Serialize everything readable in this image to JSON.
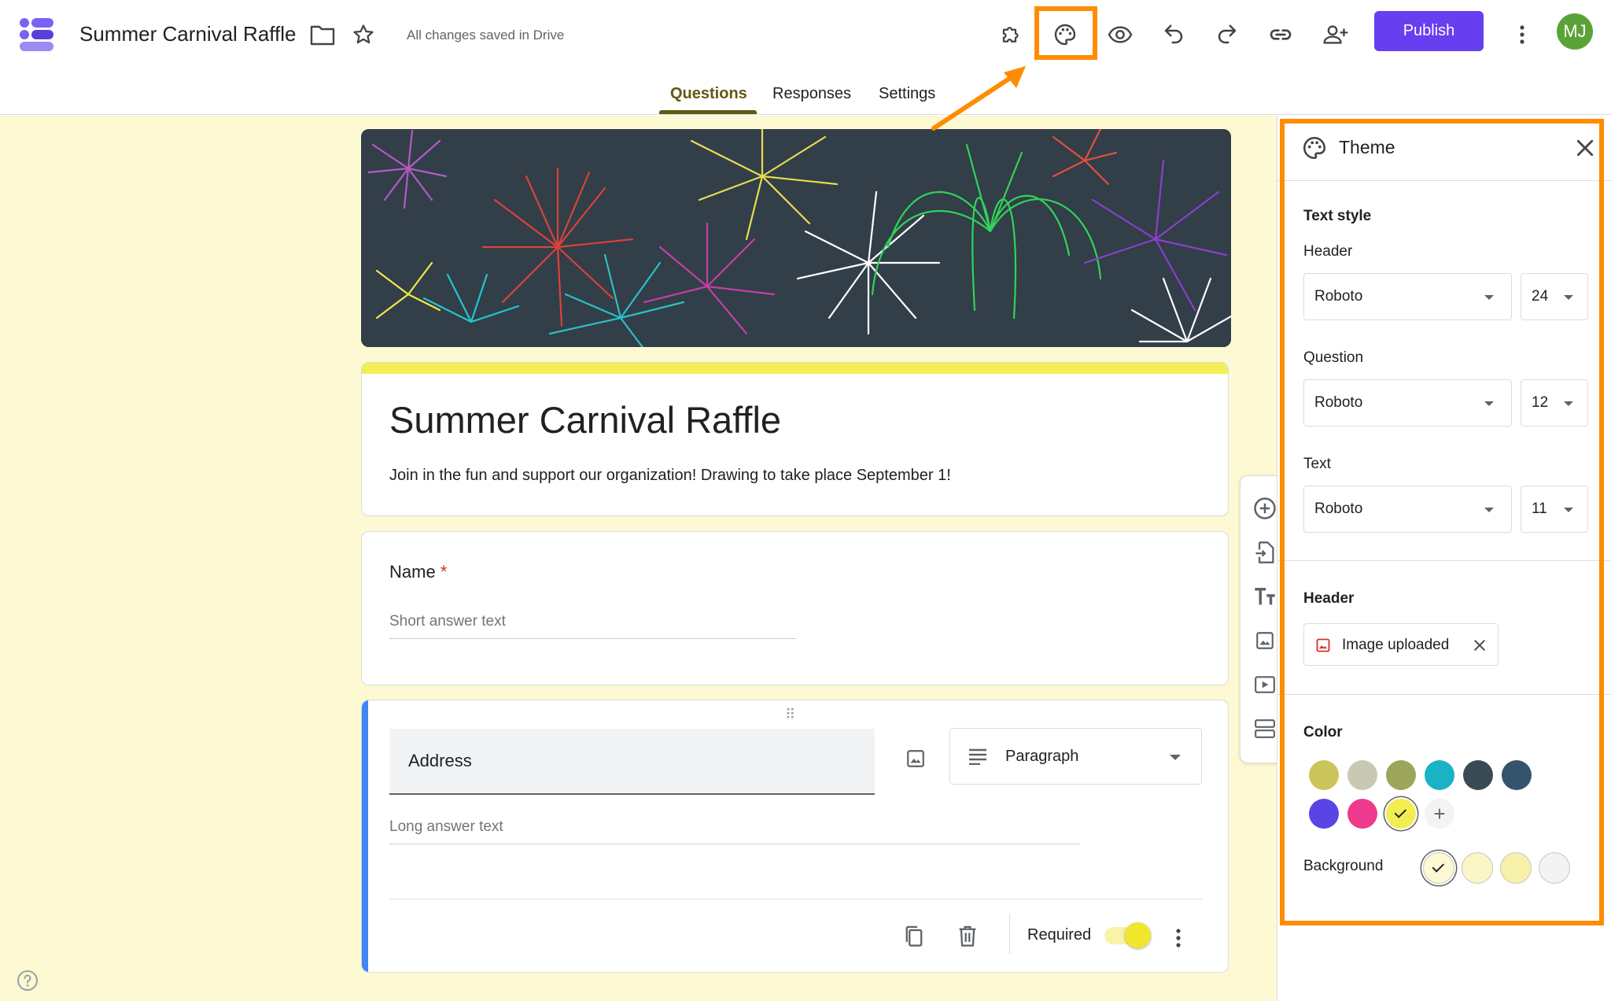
{
  "app": {
    "doc_title": "Summer Carnival Raffle",
    "save_status": "All changes saved in Drive",
    "publish_label": "Publish",
    "avatar_initials": "MJ"
  },
  "tabs": [
    {
      "label": "Questions",
      "active": true
    },
    {
      "label": "Responses",
      "active": false
    },
    {
      "label": "Settings",
      "active": false
    }
  ],
  "form": {
    "title": "Summer Carnival Raffle",
    "description": "Join in the fun and support our organization! Drawing to take place September 1!",
    "questions": [
      {
        "title": "Name",
        "required": true,
        "placeholder": "Short answer text"
      },
      {
        "title": "Address",
        "type": "Paragraph",
        "placeholder": "Long answer text",
        "required_label": "Required",
        "required": true
      }
    ]
  },
  "theme_panel": {
    "title": "Theme",
    "text_style_title": "Text style",
    "header_label": "Header",
    "header_font": "Roboto",
    "header_size": "24",
    "question_label": "Question",
    "question_font": "Roboto",
    "question_size": "12",
    "text_label": "Text",
    "text_font": "Roboto",
    "text_size": "11",
    "header_section_title": "Header",
    "header_image_label": "Image uploaded",
    "color_title": "Color",
    "background_label": "Background",
    "theme_colors": [
      "#cbc55b",
      "#c9c8b5",
      "#9da55a",
      "#19b3c3",
      "#3a4a55",
      "#35536d",
      "#5945e6",
      "#ee3a8c",
      "#f2ee52"
    ],
    "selected_color": "#f2ee52",
    "background_colors": [
      "#fcf9d3",
      "#faf6c5",
      "#f7f1a9",
      "#f3f3f3"
    ],
    "selected_background": "#fcf9d3"
  },
  "colors": {
    "accent": "#673ef0",
    "highlight": "#ff8c00",
    "form_accent": "#f2ef52",
    "canvas_bg": "#fcf9d3"
  }
}
